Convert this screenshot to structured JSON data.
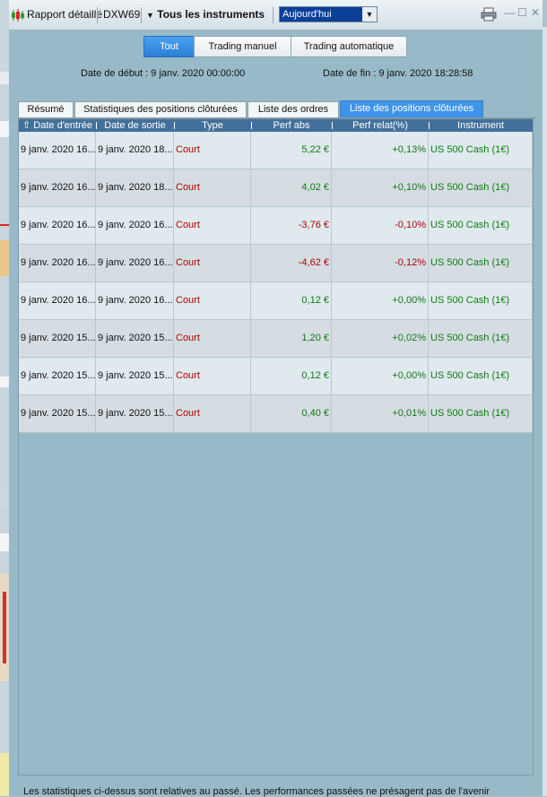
{
  "titlebar": {
    "app_label": "Rapport détaillé",
    "account": "DXW69",
    "instruments": "Tous les instruments",
    "period": "Aujourd'hui"
  },
  "filters": {
    "tabs": [
      "Tout",
      "Trading manuel",
      "Trading automatique"
    ],
    "active": "Tout"
  },
  "dates": {
    "start_label": "Date de début : 9 janv. 2020 00:00:00",
    "end_label": "Date de fin : 9 janv. 2020 18:28:58"
  },
  "tabs": {
    "items": [
      "Résumé",
      "Statistiques des positions clôturées",
      "Liste des ordres",
      "Liste des positions clôturées"
    ],
    "active": "Liste des positions clôturées"
  },
  "table": {
    "columns": [
      "Date d'entrée",
      "Date de sortie",
      "Type",
      "Perf abs",
      "Perf relat(%)",
      "Instrument"
    ],
    "rows": [
      {
        "entry": "9 janv. 2020 16...",
        "exit": "9 janv. 2020 18...",
        "type": "Court",
        "abs": "5,22 €",
        "rel": "+0,13%",
        "instrument": "US 500 Cash (1€)",
        "abs_color": "green",
        "rel_color": "green"
      },
      {
        "entry": "9 janv. 2020 16...",
        "exit": "9 janv. 2020 18...",
        "type": "Court",
        "abs": "4,02 €",
        "rel": "+0,10%",
        "instrument": "US 500 Cash (1€)",
        "abs_color": "green",
        "rel_color": "green"
      },
      {
        "entry": "9 janv. 2020 16...",
        "exit": "9 janv. 2020 16...",
        "type": "Court",
        "abs": "-3,76 €",
        "rel": "-0,10%",
        "instrument": "US 500 Cash (1€)",
        "abs_color": "red",
        "rel_color": "red"
      },
      {
        "entry": "9 janv. 2020 16...",
        "exit": "9 janv. 2020 16...",
        "type": "Court",
        "abs": "-4,62 €",
        "rel": "-0,12%",
        "instrument": "US 500 Cash (1€)",
        "abs_color": "red",
        "rel_color": "red"
      },
      {
        "entry": "9 janv. 2020 16...",
        "exit": "9 janv. 2020 16...",
        "type": "Court",
        "abs": "0,12 €",
        "rel": "+0,00%",
        "instrument": "US 500 Cash (1€)",
        "abs_color": "green",
        "rel_color": "green"
      },
      {
        "entry": "9 janv. 2020 15...",
        "exit": "9 janv. 2020 15...",
        "type": "Court",
        "abs": "1,20 €",
        "rel": "+0,02%",
        "instrument": "US 500 Cash (1€)",
        "abs_color": "green",
        "rel_color": "green"
      },
      {
        "entry": "9 janv. 2020 15...",
        "exit": "9 janv. 2020 15...",
        "type": "Court",
        "abs": "0,12 €",
        "rel": "+0,00%",
        "instrument": "US 500 Cash (1€)",
        "abs_color": "green",
        "rel_color": "green"
      },
      {
        "entry": "9 janv. 2020 15...",
        "exit": "9 janv. 2020 15...",
        "type": "Court",
        "abs": "0,40 €",
        "rel": "+0,01%",
        "instrument": "US 500 Cash (1€)",
        "abs_color": "green",
        "rel_color": "green"
      }
    ]
  },
  "footer": "Les statistiques ci-dessus sont relatives au passé. Les performances passées ne présagent pas de l'avenir",
  "colors": {
    "accent": "#3e94ea",
    "header": "#43709a",
    "positive": "#117a11",
    "negative": "#b00000"
  },
  "icons": [
    "candlestick-icon",
    "chevron-down-icon",
    "printer-icon",
    "minimize-icon",
    "maximize-icon",
    "close-icon",
    "sort-up-icon"
  ]
}
